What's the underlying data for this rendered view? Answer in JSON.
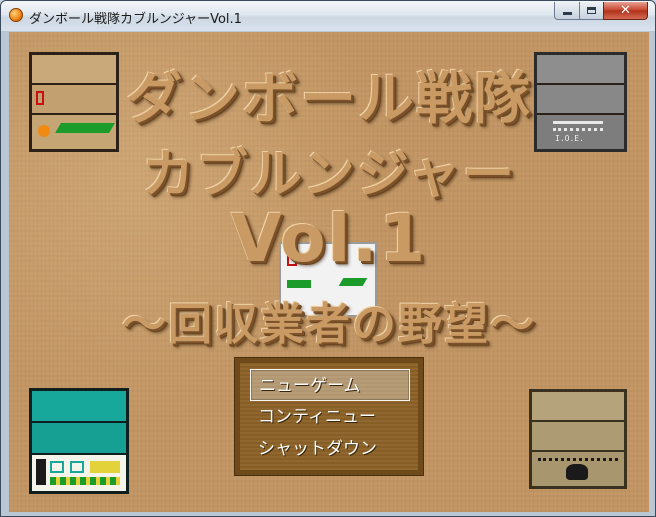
{
  "window": {
    "title": "ダンボール戦隊カブルンジャーVol.1",
    "controls": {
      "close_label": "✕"
    }
  },
  "title_screen": {
    "line1": "ダンボール戦隊",
    "line2": "カブルンジャー",
    "line3": "Vol.1",
    "line4": "～回収業者の野望～"
  },
  "menu": {
    "items": [
      "ニューゲーム",
      "コンティニュー",
      "シャットダウン"
    ],
    "selected_index": 0
  },
  "colors": {
    "background": "#c49866",
    "menu_bg": "#8b6227",
    "teal_panel": "#18a79b",
    "gray_panel": "#8c8c8c"
  },
  "panels": {
    "top_right_caption": "I.O.E."
  }
}
